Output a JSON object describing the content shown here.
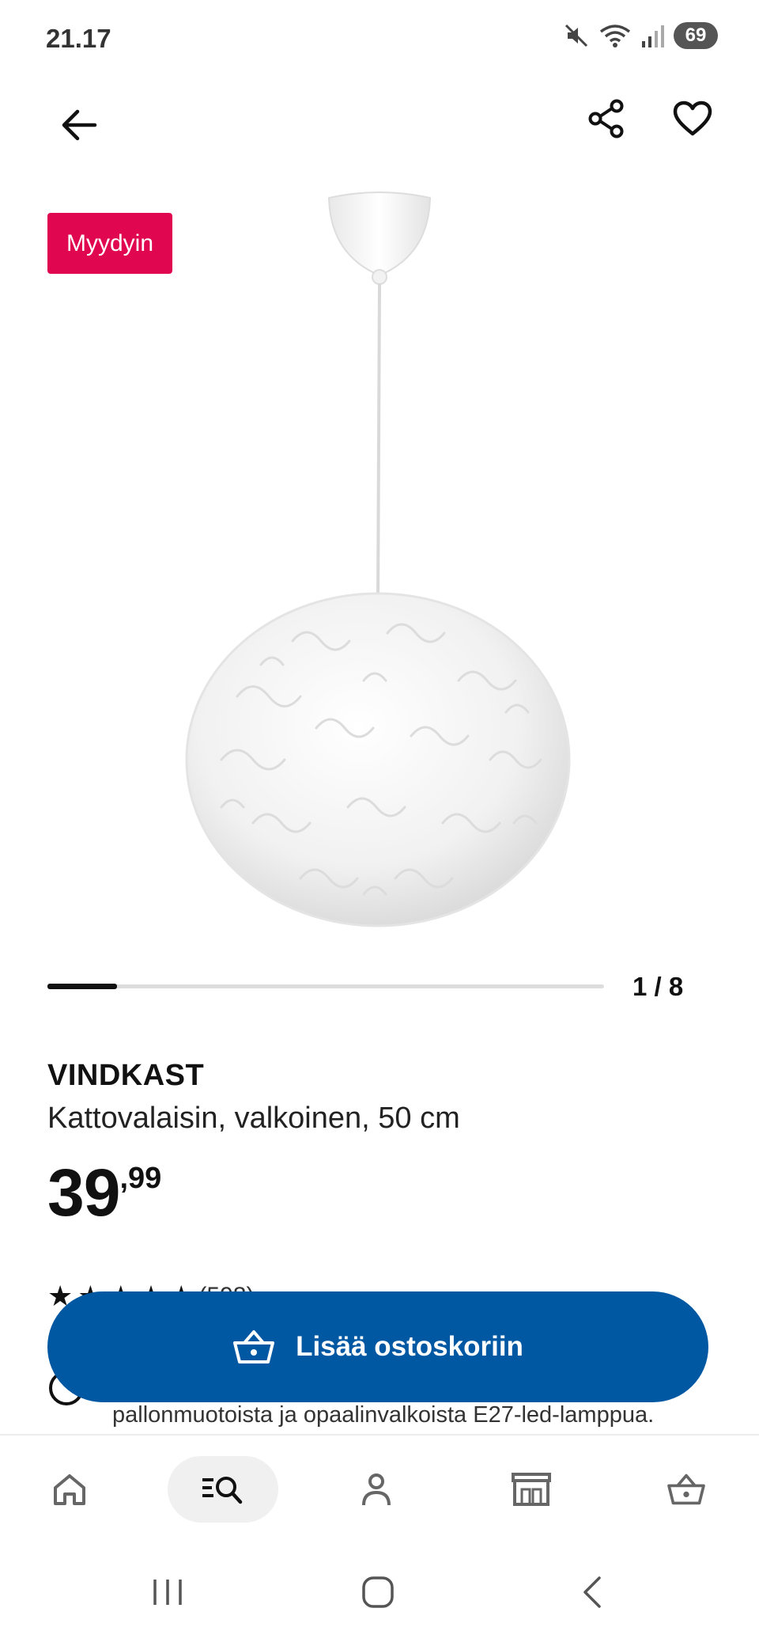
{
  "status_bar": {
    "time": "21.17",
    "battery": "69",
    "icons": [
      "mute-icon",
      "wifi-icon",
      "signal-icon",
      "battery-icon"
    ]
  },
  "top_bar": {
    "icons": [
      "back-arrow-icon",
      "share-icon",
      "heart-icon"
    ]
  },
  "badge": {
    "label": "Myydyin",
    "color": "#e0064f"
  },
  "gallery": {
    "counter": "1 / 8",
    "progress": 0.125
  },
  "product": {
    "name": "VINDKAST",
    "description": "Kattovalaisin, valkoinen, 50 cm",
    "price_integer": "39",
    "price_decimal": ",99"
  },
  "rating": {
    "stars": 4.5,
    "count": "(598)"
  },
  "info": {
    "text": "pallonmuotoista ja opaalinvalkoista E27-led-lamppua."
  },
  "add_to_cart": {
    "label": "Lisää ostoskoriin",
    "color": "#0058a3"
  },
  "bottom_nav": {
    "items": [
      "home-icon",
      "search-icon",
      "profile-icon",
      "store-icon",
      "cart-icon"
    ],
    "active": "search-icon"
  },
  "system_nav": [
    "recent-apps-icon",
    "home-button-icon",
    "back-icon"
  ]
}
